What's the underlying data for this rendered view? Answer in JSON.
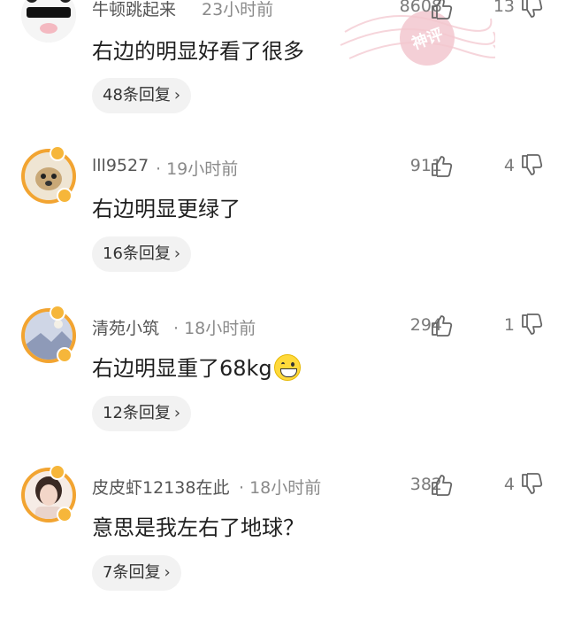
{
  "comments": [
    {
      "username": "牛顿跳起来",
      "time": "23小时前",
      "likes": "8608",
      "dislikes": "13",
      "text": "右边的明显好看了很多",
      "replies": "48条回复",
      "avatar": "avatar-panda-sunglasses"
    },
    {
      "username": "lll9527",
      "time": "· 19小时前",
      "likes": "911",
      "dislikes": "4",
      "text": "右边明显更绿了",
      "replies": "16条回复",
      "avatar": "avatar-dog"
    },
    {
      "username": "清苑小筑",
      "time": "· 18小时前",
      "likes": "294",
      "dislikes": "1",
      "text": "右边明显重了68kg",
      "replies": "12条回复",
      "avatar": "avatar-landscape"
    },
    {
      "username": "皮皮虾12138在此",
      "time": "· 18小时前",
      "likes": "382",
      "dislikes": "4",
      "text": "意思是我左右了地球？",
      "replies": "7条回复",
      "avatar": "avatar-girl"
    }
  ],
  "stamp_text": "神评",
  "colors": {
    "ring": "#f2a431",
    "pill": "#f2f2f2",
    "meta": "#8a8a8a"
  }
}
